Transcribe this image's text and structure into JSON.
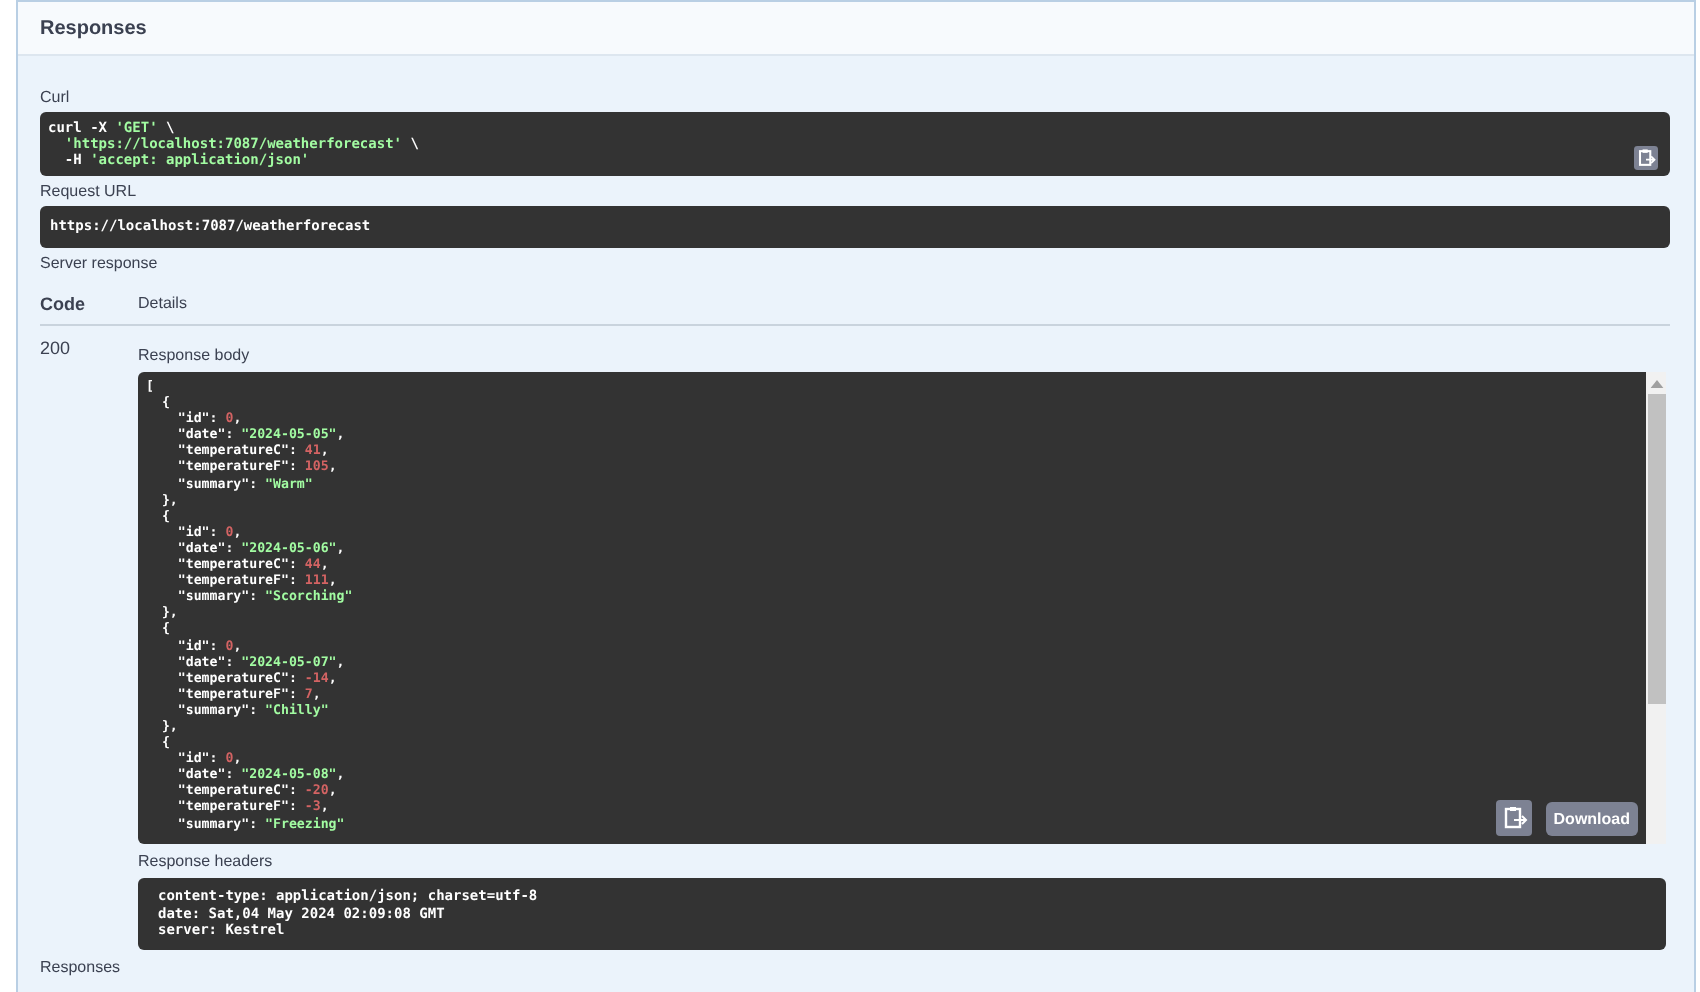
{
  "section_title": "Responses",
  "curl": {
    "label": "Curl",
    "lines": [
      [
        {
          "text": "curl -X ",
          "kind": "plain"
        },
        {
          "text": "'GET'",
          "kind": "string"
        },
        {
          "text": " \\",
          "kind": "plain"
        }
      ],
      [
        {
          "text": "  'https://localhost:7087/weatherforecast'",
          "kind": "string"
        },
        {
          "text": " \\",
          "kind": "plain"
        }
      ],
      [
        {
          "text": "  -H ",
          "kind": "plain"
        },
        {
          "text": "'accept: application/json'",
          "kind": "string"
        }
      ]
    ]
  },
  "request_url": {
    "label": "Request URL",
    "value": "https://localhost:7087/weatherforecast"
  },
  "server_response": {
    "label": "Server response",
    "columns": [
      "Code",
      "Details"
    ],
    "code": "200",
    "body": {
      "label": "Response body",
      "lines": [
        [
          {
            "text": "[",
            "kind": "plain"
          }
        ],
        [
          {
            "text": "  {",
            "kind": "plain"
          }
        ],
        [
          {
            "text": "    \"id\": ",
            "kind": "plain"
          },
          {
            "text": "0",
            "kind": "number"
          },
          {
            "text": ",",
            "kind": "plain"
          }
        ],
        [
          {
            "text": "    \"date\": ",
            "kind": "plain"
          },
          {
            "text": "\"2024-05-05\"",
            "kind": "string"
          },
          {
            "text": ",",
            "kind": "plain"
          }
        ],
        [
          {
            "text": "    \"temperatureC\": ",
            "kind": "plain"
          },
          {
            "text": "41",
            "kind": "number"
          },
          {
            "text": ",",
            "kind": "plain"
          }
        ],
        [
          {
            "text": "    \"temperatureF\": ",
            "kind": "plain"
          },
          {
            "text": "105",
            "kind": "number"
          },
          {
            "text": ",",
            "kind": "plain"
          }
        ],
        [
          {
            "text": "    \"summary\": ",
            "kind": "plain"
          },
          {
            "text": "\"Warm\"",
            "kind": "string"
          }
        ],
        [
          {
            "text": "  },",
            "kind": "plain"
          }
        ],
        [
          {
            "text": "  {",
            "kind": "plain"
          }
        ],
        [
          {
            "text": "    \"id\": ",
            "kind": "plain"
          },
          {
            "text": "0",
            "kind": "number"
          },
          {
            "text": ",",
            "kind": "plain"
          }
        ],
        [
          {
            "text": "    \"date\": ",
            "kind": "plain"
          },
          {
            "text": "\"2024-05-06\"",
            "kind": "string"
          },
          {
            "text": ",",
            "kind": "plain"
          }
        ],
        [
          {
            "text": "    \"temperatureC\": ",
            "kind": "plain"
          },
          {
            "text": "44",
            "kind": "number"
          },
          {
            "text": ",",
            "kind": "plain"
          }
        ],
        [
          {
            "text": "    \"temperatureF\": ",
            "kind": "plain"
          },
          {
            "text": "111",
            "kind": "number"
          },
          {
            "text": ",",
            "kind": "plain"
          }
        ],
        [
          {
            "text": "    \"summary\": ",
            "kind": "plain"
          },
          {
            "text": "\"Scorching\"",
            "kind": "string"
          }
        ],
        [
          {
            "text": "  },",
            "kind": "plain"
          }
        ],
        [
          {
            "text": "  {",
            "kind": "plain"
          }
        ],
        [
          {
            "text": "    \"id\": ",
            "kind": "plain"
          },
          {
            "text": "0",
            "kind": "number"
          },
          {
            "text": ",",
            "kind": "plain"
          }
        ],
        [
          {
            "text": "    \"date\": ",
            "kind": "plain"
          },
          {
            "text": "\"2024-05-07\"",
            "kind": "string"
          },
          {
            "text": ",",
            "kind": "plain"
          }
        ],
        [
          {
            "text": "    \"temperatureC\": ",
            "kind": "plain"
          },
          {
            "text": "-14",
            "kind": "number"
          },
          {
            "text": ",",
            "kind": "plain"
          }
        ],
        [
          {
            "text": "    \"temperatureF\": ",
            "kind": "plain"
          },
          {
            "text": "7",
            "kind": "number"
          },
          {
            "text": ",",
            "kind": "plain"
          }
        ],
        [
          {
            "text": "    \"summary\": ",
            "kind": "plain"
          },
          {
            "text": "\"Chilly\"",
            "kind": "string"
          }
        ],
        [
          {
            "text": "  },",
            "kind": "plain"
          }
        ],
        [
          {
            "text": "  {",
            "kind": "plain"
          }
        ],
        [
          {
            "text": "    \"id\": ",
            "kind": "plain"
          },
          {
            "text": "0",
            "kind": "number"
          },
          {
            "text": ",",
            "kind": "plain"
          }
        ],
        [
          {
            "text": "    \"date\": ",
            "kind": "plain"
          },
          {
            "text": "\"2024-05-08\"",
            "kind": "string"
          },
          {
            "text": ",",
            "kind": "plain"
          }
        ],
        [
          {
            "text": "    \"temperatureC\": ",
            "kind": "plain"
          },
          {
            "text": "-20",
            "kind": "number"
          },
          {
            "text": ",",
            "kind": "plain"
          }
        ],
        [
          {
            "text": "    \"temperatureF\": ",
            "kind": "plain"
          },
          {
            "text": "-3",
            "kind": "number"
          },
          {
            "text": ",",
            "kind": "plain"
          }
        ],
        [
          {
            "text": "    \"summary\": ",
            "kind": "plain"
          },
          {
            "text": "\"Freezing\"",
            "kind": "string"
          }
        ]
      ],
      "download_button": "Download"
    },
    "headers": {
      "label": "Response headers",
      "lines": [
        "content-type: application/json; charset=utf-8",
        "date: Sat,04 May 2024 02:09:08 GMT",
        "server: Kestrel"
      ]
    }
  },
  "footer_title": "Responses"
}
